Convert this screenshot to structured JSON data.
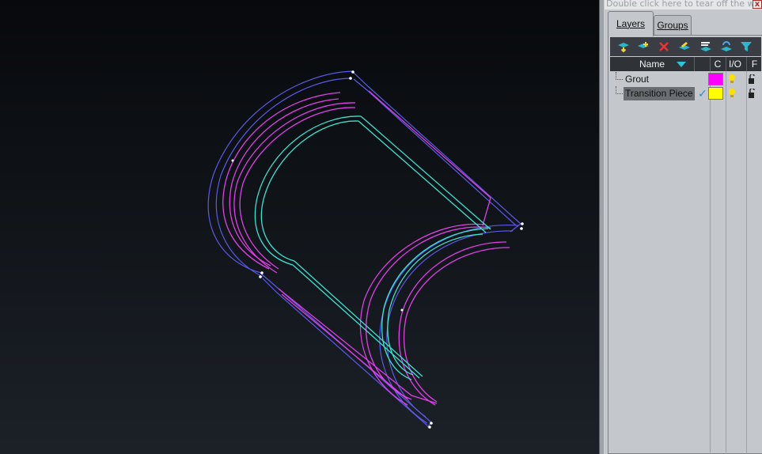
{
  "panel": {
    "tearoff_text": "Double click here to tear off the wi",
    "close_glyph": "x",
    "tabs": [
      {
        "label": "Layers",
        "active": true
      },
      {
        "label": "Groups",
        "active": false
      }
    ],
    "toolbar": [
      {
        "icon": "new-layer-icon"
      },
      {
        "icon": "add-layer-icon"
      },
      {
        "icon": "delete-layer-icon"
      },
      {
        "icon": "layer-properties-icon"
      },
      {
        "icon": "layer-states-icon"
      },
      {
        "icon": "refresh-layers-icon"
      },
      {
        "icon": "filter-icon"
      }
    ],
    "columns": {
      "name": "Name",
      "color": "C",
      "io": "I/O",
      "freeze": "F"
    },
    "layers": [
      {
        "name": "Grout",
        "color": "#ff00ff",
        "current": false,
        "selected": false
      },
      {
        "name": "Transition Piece",
        "color": "#ffff00",
        "current": true,
        "selected": true
      }
    ]
  },
  "viewport": {
    "background": "#0b0d10",
    "layer_colors": {
      "grout": "#e040e8",
      "transition": "#40e0d0",
      "outline": "#5a5ae6"
    }
  }
}
